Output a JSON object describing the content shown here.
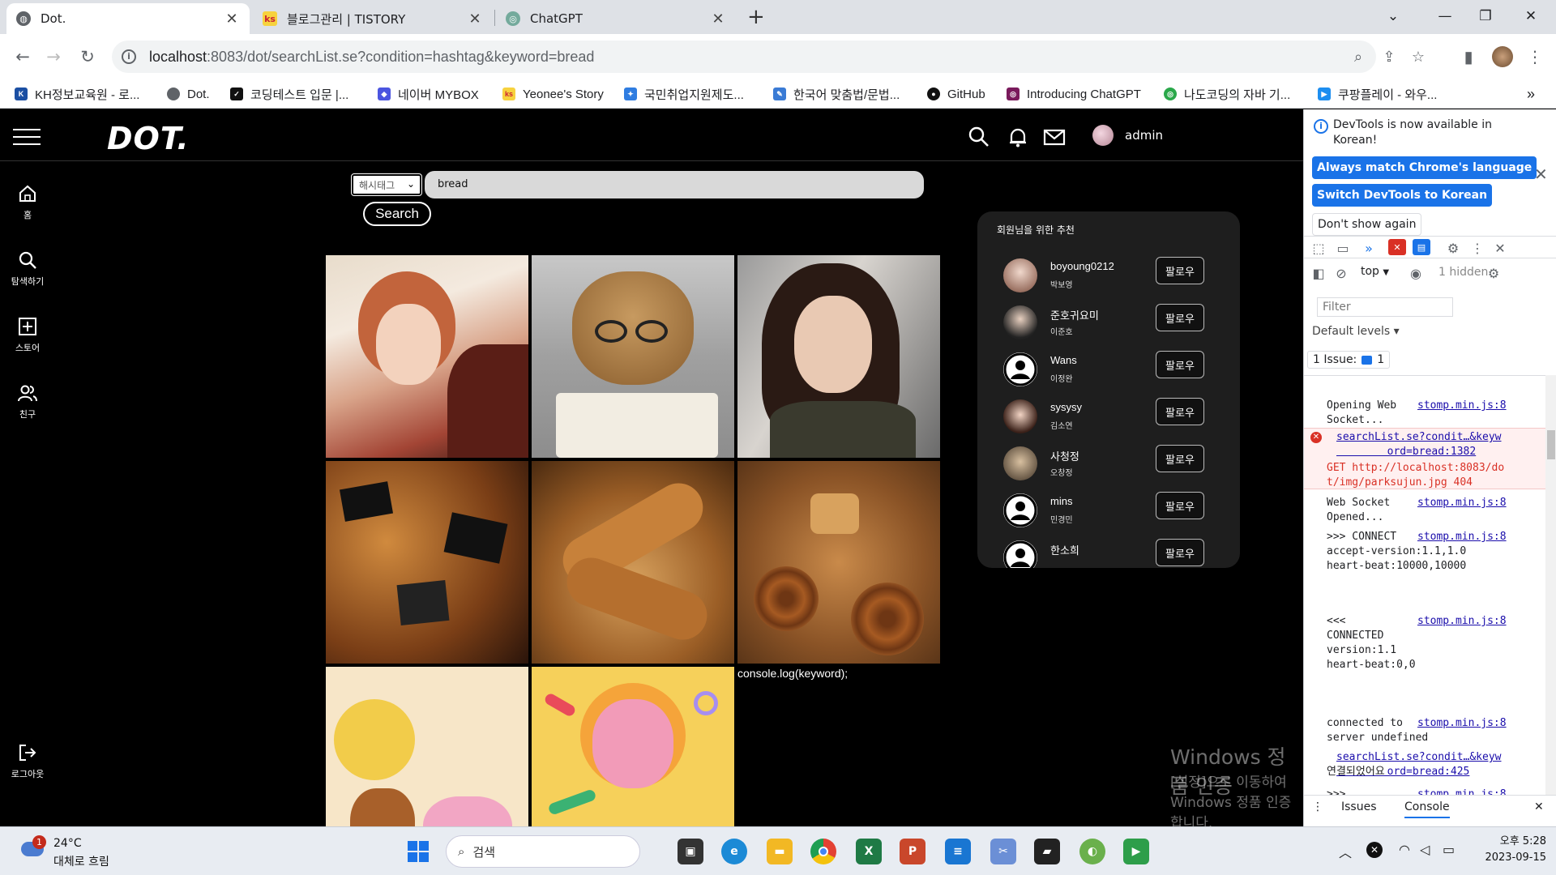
{
  "browser": {
    "tabs": [
      {
        "label": "Dot.",
        "active": true
      },
      {
        "label": "블로그관리 | TISTORY",
        "active": false
      },
      {
        "label": "ChatGPT",
        "active": false
      }
    ],
    "url_host": "localhost",
    "url_path": ":8083/dot/searchList.se?condition=hashtag&keyword=bread",
    "bookmarks": [
      "KH정보교육원 - 로...",
      "Dot.",
      "코딩테스트 입문 |...",
      "네이버 MYBOX",
      "Yeonee's Story",
      "국민취업지원제도...",
      "한국어 맞춤법/문법...",
      "GitHub",
      "Introducing ChatGPT",
      "나도코딩의 자바 기...",
      "쿠팡플레이 - 와우..."
    ],
    "bookmarks_more": "»"
  },
  "site": {
    "logo": "DOT.",
    "username": "admin",
    "side_menu": {
      "home": "홈",
      "explore": "탐색하기",
      "store": "스토어",
      "friends": "친구",
      "logout": "로그아웃"
    },
    "search": {
      "condition": "해시태그",
      "keyword": "bread",
      "button": "Search"
    },
    "console_text": "console.log(keyword);",
    "recommend": {
      "title": "회원님을 위한 추천",
      "follow_label": "팔로우",
      "users": [
        {
          "nick": "boyoung0212",
          "name": "박보영"
        },
        {
          "nick": "준호귀요미",
          "name": "이준호"
        },
        {
          "nick": "Wans",
          "name": "이정완"
        },
        {
          "nick": "sysysy",
          "name": "김소연"
        },
        {
          "nick": "사청정",
          "name": "오창정"
        },
        {
          "nick": "mins",
          "name": "민경민"
        },
        {
          "nick": "한소희",
          "name": ""
        }
      ]
    },
    "watermark_line1": "Windows 정품 인증",
    "watermark_line2": "[설정]으로 이동하여 Windows 정품 인증합니다."
  },
  "devtools": {
    "info_text": "DevTools is now available in Korean!",
    "btn_match": "Always match Chrome's language",
    "btn_switch": "Switch DevTools to Korean",
    "btn_dont": "Don't show again",
    "context": "top",
    "hidden": "1 hidden",
    "filter_placeholder": "Filter",
    "levels": "Default levels ▾",
    "issue_label": "1 Issue:",
    "issue_count": "1",
    "logs": [
      {
        "text": "Opening Web\nSocket...",
        "src": "stomp.min.js:8"
      },
      {
        "text": "GET http://localhost:8083/do\nt/img/parksujun.jpg 404",
        "src": "searchList.se?condit…&keyw\n        ord=bread:1382"
      },
      {
        "text": "Web Socket\nOpened...",
        "src": "stomp.min.js:8"
      },
      {
        "text": ">>> CONNECT\naccept-version:1.1,1.0\nheart-beat:10000,10000",
        "src": "stomp.min.js:8"
      },
      {
        "text": "<<<\nCONNECTED\nversion:1.1\nheart-beat:0,0",
        "src": "stomp.min.js:8"
      },
      {
        "text": "connected to\nserver undefined",
        "src": "stomp.min.js:8"
      },
      {
        "text": "연결되었어요",
        "src": "searchList.se?condit…&keyw\n        ord=bread:425"
      },
      {
        "text": ">>>",
        "src": "stomp.min.js:8"
      }
    ],
    "tab_issues": "Issues",
    "tab_console": "Console"
  },
  "taskbar": {
    "weather_temp": "24°C",
    "weather_cond": "대체로 흐림",
    "weather_badge": "1",
    "search_label": "검색",
    "time": "오후 5:28",
    "date": "2023-09-15"
  }
}
